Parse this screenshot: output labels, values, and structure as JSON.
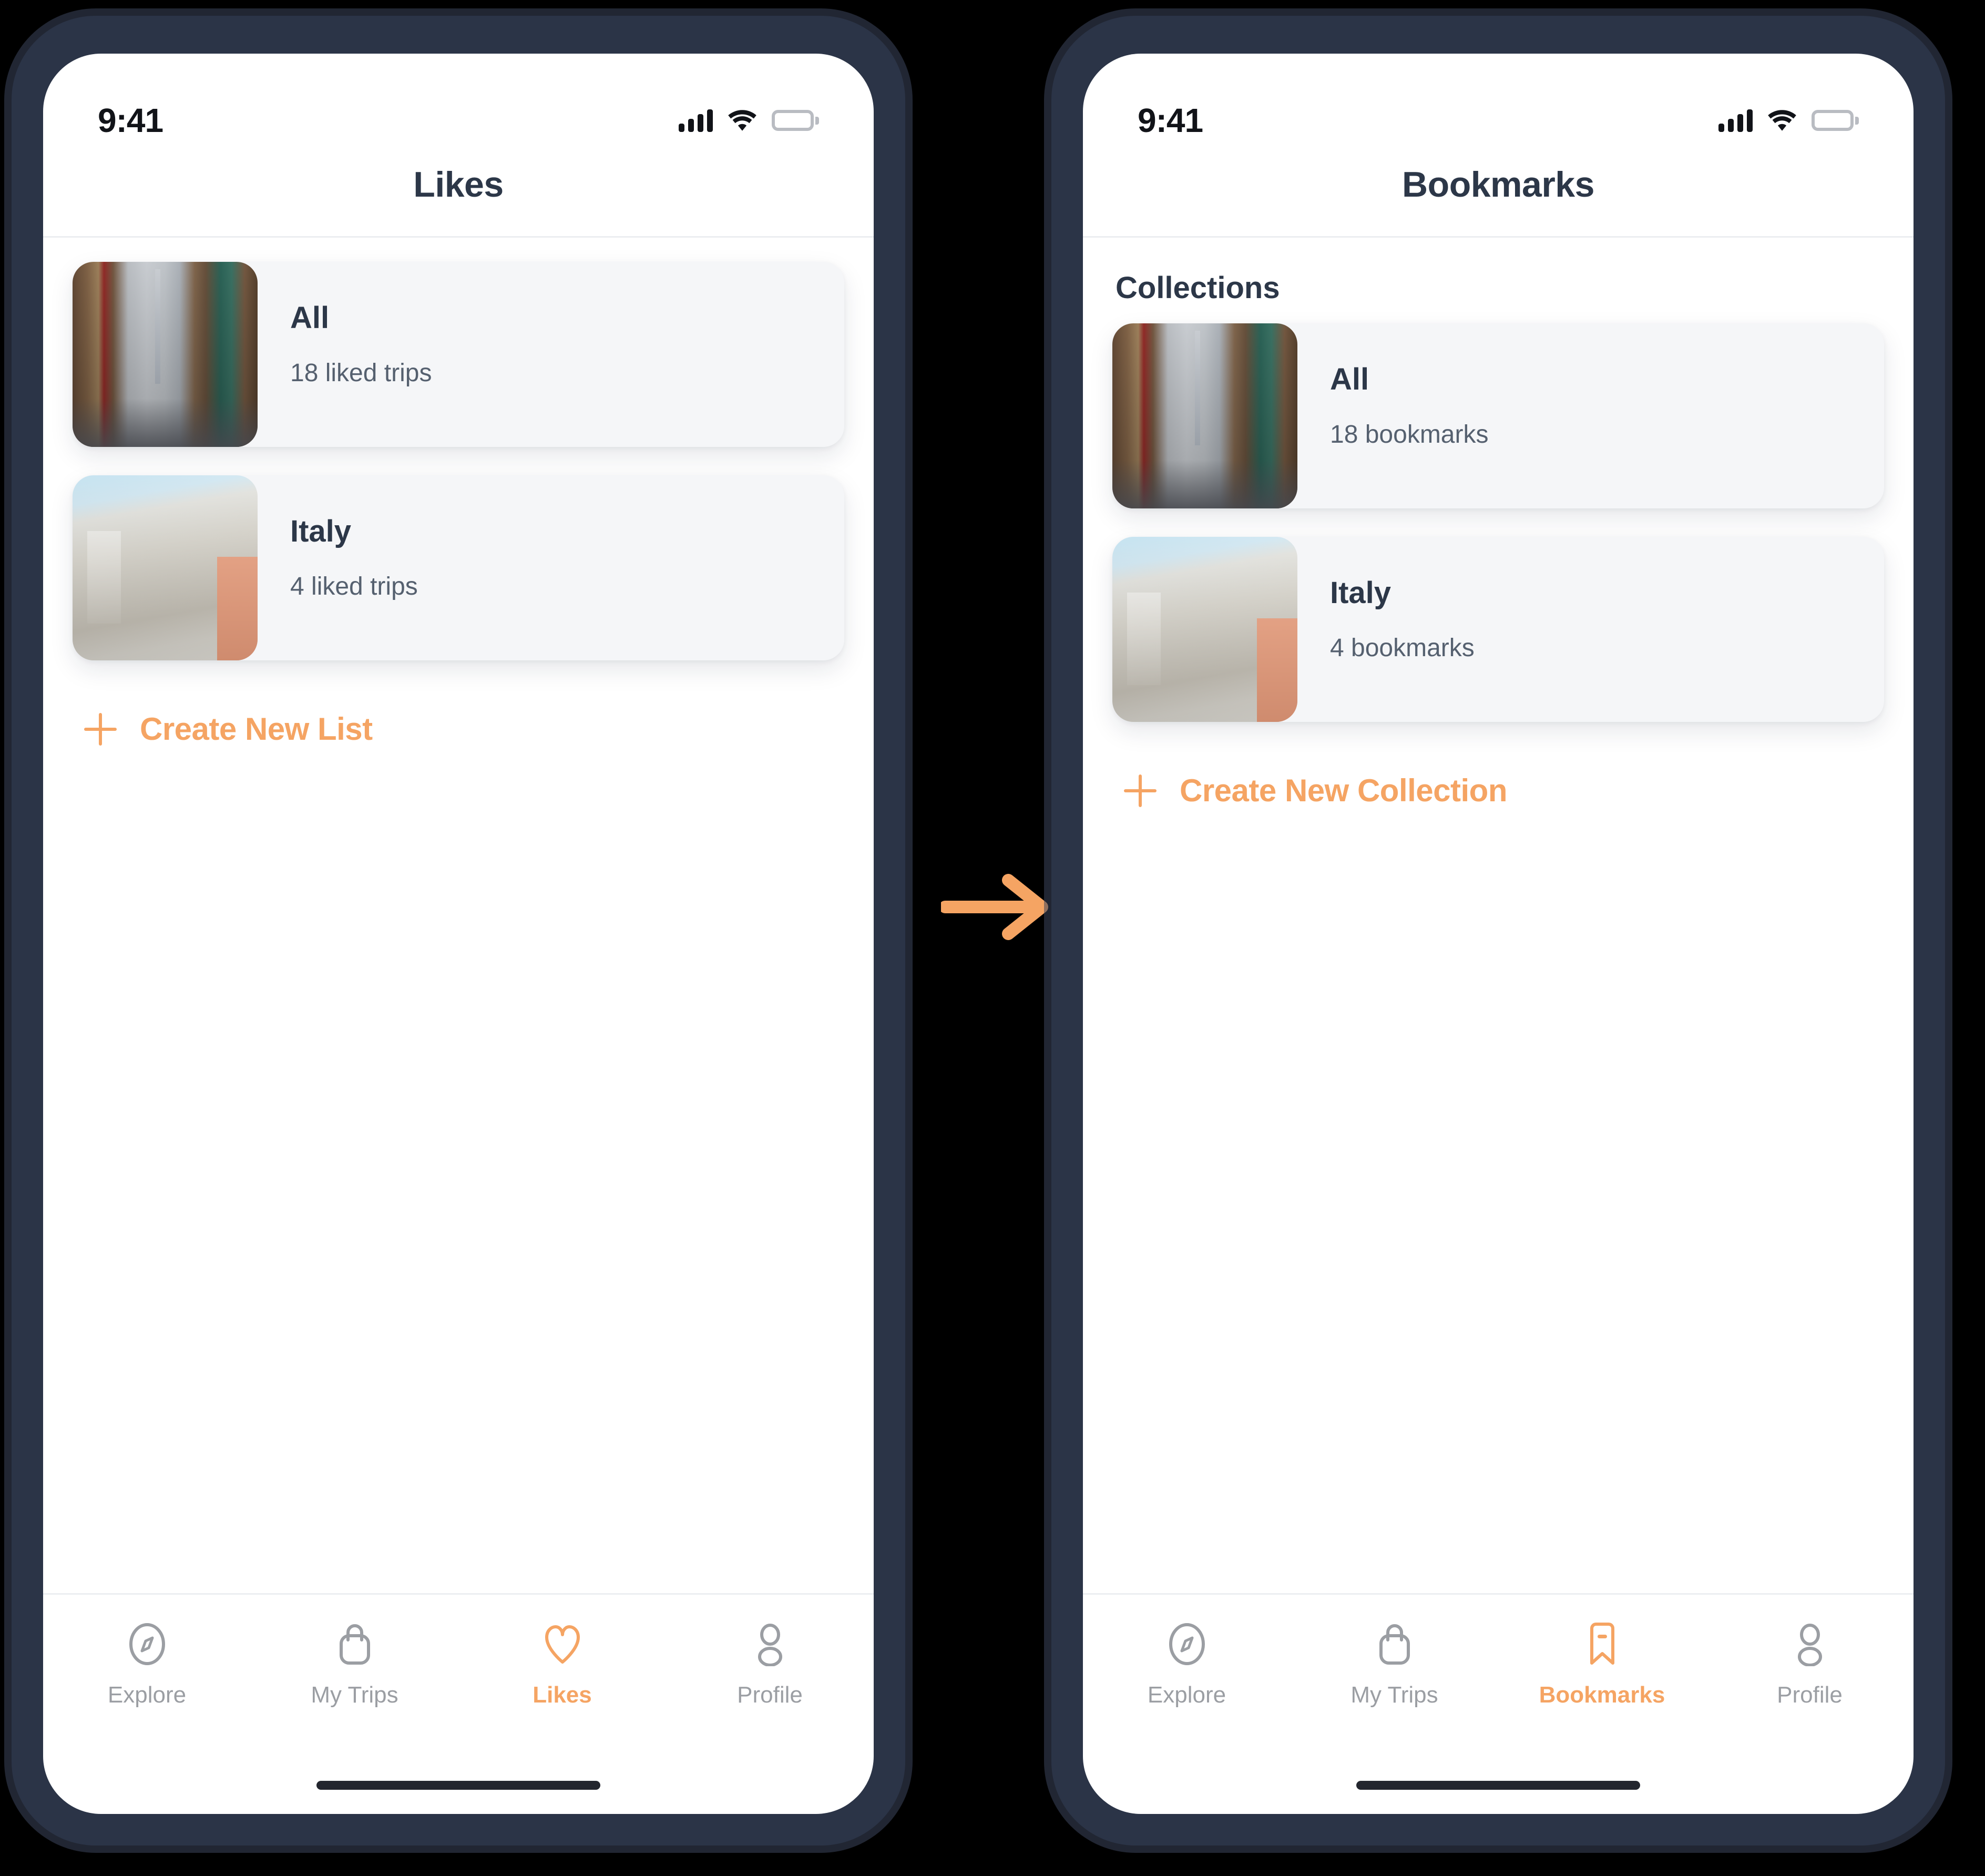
{
  "colors": {
    "accent": "#f5a463",
    "text_dark": "#2c3748",
    "text_muted": "#55606f",
    "tab_inactive": "#9b9ea3",
    "card_bg": "#f5f6f8",
    "frame": "#2b3447",
    "canvas": "#000000"
  },
  "flow": {
    "arrow_icon": "arrow-right-icon"
  },
  "screens": [
    {
      "id": "likes",
      "status_bar": {
        "time": "9:41",
        "signal_icon": "cellular-signal-icon",
        "wifi_icon": "wifi-icon",
        "battery_icon": "battery-full-icon"
      },
      "nav": {
        "title": "Likes"
      },
      "section_heading": null,
      "cards": [
        {
          "thumb": "tokyo-street-photo",
          "title": "All",
          "subtitle": "18 liked trips"
        },
        {
          "thumb": "trevi-fountain-photo",
          "title": "Italy",
          "subtitle": "4 liked trips"
        }
      ],
      "create_action": {
        "icon": "plus-icon",
        "label": "Create New List"
      },
      "tabs": [
        {
          "icon": "compass-icon",
          "label": "Explore",
          "active": false
        },
        {
          "icon": "bag-icon",
          "label": "My Trips",
          "active": false
        },
        {
          "icon": "heart-icon",
          "label": "Likes",
          "active": true
        },
        {
          "icon": "person-icon",
          "label": "Profile",
          "active": false
        }
      ]
    },
    {
      "id": "bookmarks",
      "status_bar": {
        "time": "9:41",
        "signal_icon": "cellular-signal-icon",
        "wifi_icon": "wifi-icon",
        "battery_icon": "battery-full-icon"
      },
      "nav": {
        "title": "Bookmarks"
      },
      "section_heading": "Collections",
      "cards": [
        {
          "thumb": "tokyo-street-photo",
          "title": "All",
          "subtitle": "18 bookmarks"
        },
        {
          "thumb": "trevi-fountain-photo",
          "title": "Italy",
          "subtitle": "4 bookmarks"
        }
      ],
      "create_action": {
        "icon": "plus-icon",
        "label": "Create New Collection"
      },
      "tabs": [
        {
          "icon": "compass-icon",
          "label": "Explore",
          "active": false
        },
        {
          "icon": "bag-icon",
          "label": "My Trips",
          "active": false
        },
        {
          "icon": "bookmark-icon",
          "label": "Bookmarks",
          "active": true
        },
        {
          "icon": "person-icon",
          "label": "Profile",
          "active": false
        }
      ]
    }
  ]
}
